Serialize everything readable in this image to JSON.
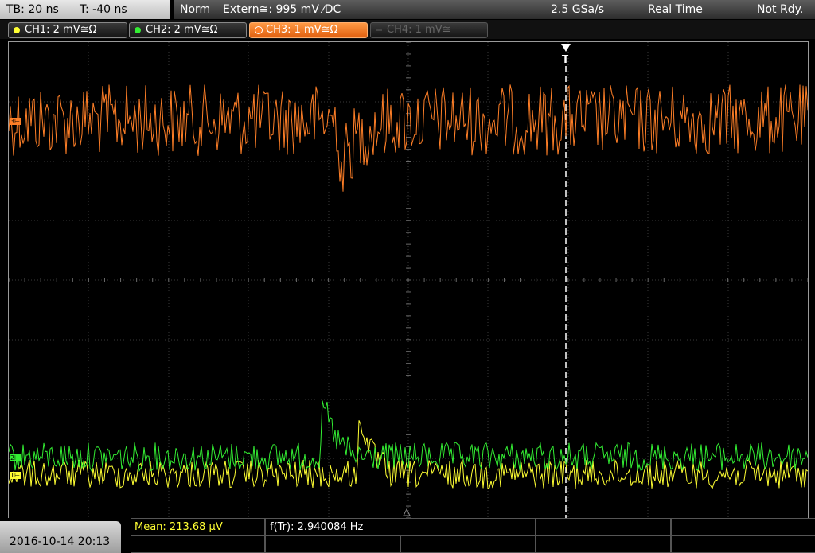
{
  "timebase": {
    "tb": "TB: 20 ns",
    "t": "T: -40 ns"
  },
  "acquisition": {
    "mode": "Norm",
    "trigger": "Extern≅: 995 mV ⁄DC",
    "rate": "2.5 GSa/s",
    "realtime": "Real Time",
    "status": "Not Rdy."
  },
  "channels": [
    {
      "label": "CH1: 2 mV≅Ω",
      "color": "#ffff33",
      "active": true
    },
    {
      "label": "CH2: 2 mV≅Ω",
      "color": "#33ee33",
      "active": true
    },
    {
      "label": "CH3: 1 mV≅Ω",
      "color": "#ff7f27",
      "active": true,
      "selected": true
    },
    {
      "label": "CH4: 1 mV≅",
      "color": "#555555",
      "active": false
    }
  ],
  "trigger_marker": "T",
  "footer": {
    "datetime": "2016-10-14 20:13",
    "mean": "Mean: 213.68 µV",
    "freq": "f(Tr): 2.940084 Hz"
  },
  "colors": {
    "ch1": "#ffff33",
    "ch2": "#33ee33",
    "ch3": "#ff7f27"
  },
  "icons": [
    "trigger-arrow-icon",
    "channel-dot-icon"
  ]
}
